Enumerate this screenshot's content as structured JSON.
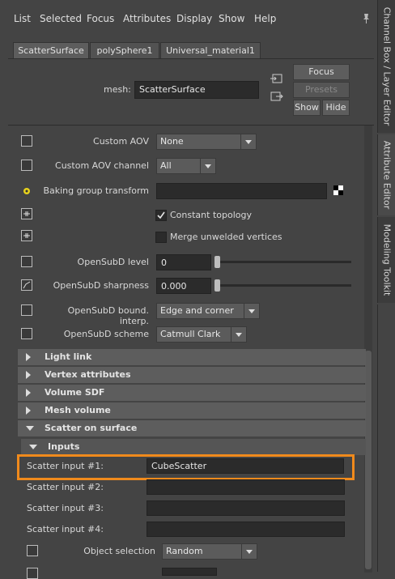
{
  "menu": [
    "List",
    "Selected",
    "Focus",
    "Attributes",
    "Display",
    "Show",
    "Help"
  ],
  "tabs": [
    "ScatterSurface",
    "polySphere1",
    "Universal_material1"
  ],
  "header": {
    "mesh_label": "mesh:",
    "mesh_value": "ScatterSurface",
    "focus": "Focus",
    "presets": "Presets",
    "show": "Show",
    "hide": "Hide"
  },
  "rows": {
    "custom_aov": {
      "label": "Custom AOV",
      "value": "None"
    },
    "custom_aov_channel": {
      "label": "Custom AOV channel",
      "value": "All"
    },
    "baking_group": {
      "label": "Baking group transform",
      "value": ""
    },
    "constant_topology": {
      "label": "Constant topology",
      "checked": true
    },
    "merge_unwelded": {
      "label": "Merge unwelded vertices",
      "checked": false
    },
    "opensubd_level": {
      "label": "OpenSubD level",
      "value": "0"
    },
    "opensubd_sharpness": {
      "label": "OpenSubD sharpness",
      "value": "0.000"
    },
    "opensubd_bound": {
      "label": "OpenSubD bound. interp.",
      "value": "Edge and corner"
    },
    "opensubd_scheme": {
      "label": "OpenSubD scheme",
      "value": "Catmull Clark"
    }
  },
  "sections": {
    "light_link": "Light link",
    "vertex_attributes": "Vertex attributes",
    "volume_sdf": "Volume SDF",
    "mesh_volume": "Mesh volume",
    "scatter_on_surface": "Scatter on surface",
    "inputs": "Inputs"
  },
  "scatter_inputs": [
    {
      "label": "Scatter input #1:",
      "value": "CubeScatter"
    },
    {
      "label": "Scatter input #2:",
      "value": ""
    },
    {
      "label": "Scatter input #3:",
      "value": ""
    },
    {
      "label": "Scatter input #4:",
      "value": ""
    }
  ],
  "object_selection": {
    "label": "Object selection",
    "value": "Random"
  },
  "dock_tabs": [
    "Channel Box / Layer Editor",
    "Attribute Editor",
    "Modeling Toolkit"
  ],
  "highlight_color": "#f08a1c"
}
